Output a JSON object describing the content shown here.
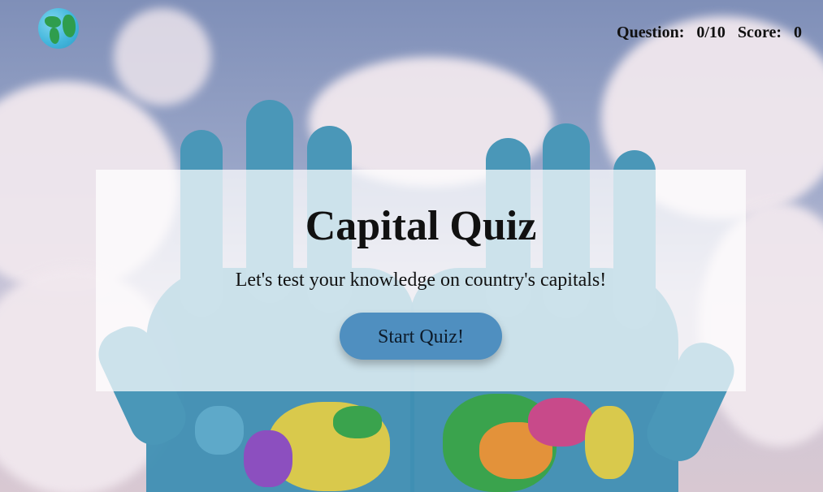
{
  "header": {
    "logo_icon": "globe-icon",
    "question_label": "Question:",
    "question_progress": "0/10",
    "score_label": "Score:",
    "score_value": "0"
  },
  "main": {
    "title": "Capital Quiz",
    "subtitle": "Let's test your knowledge on country's capitals!",
    "start_button_label": "Start Quiz!"
  },
  "colors": {
    "button": "#4f8fc0",
    "card_overlay": "rgba(255,255,255,0.72)"
  }
}
